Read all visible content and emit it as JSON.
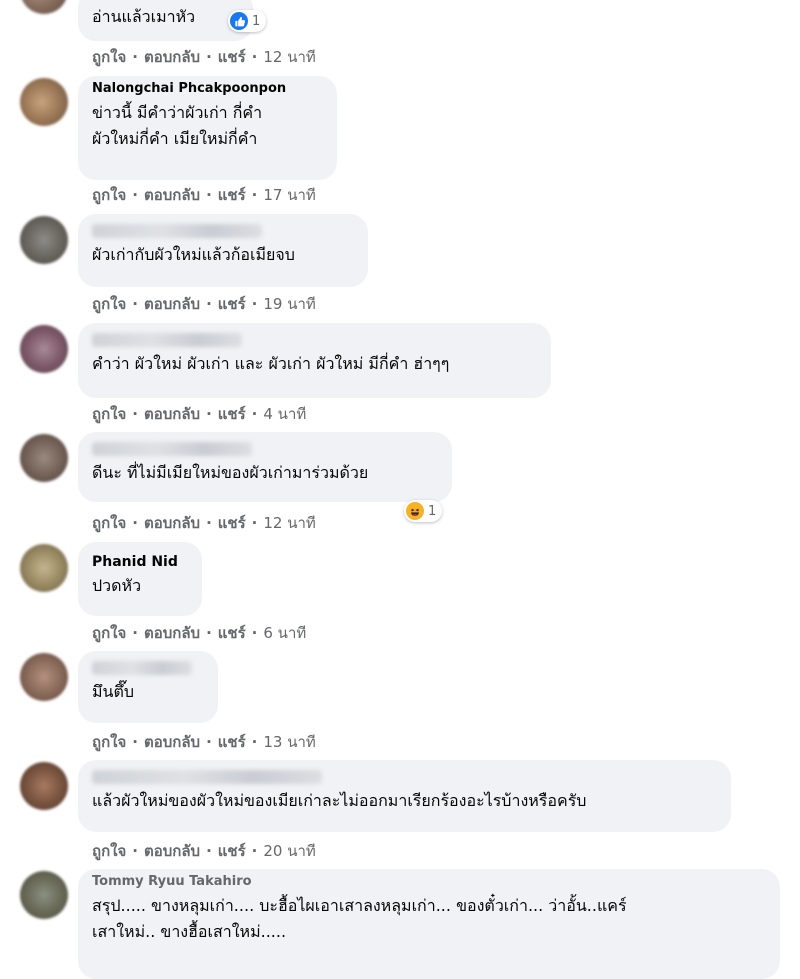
{
  "comments": [
    {
      "author": "",
      "text": [
        "อ่านแล้วเมาหัว"
      ],
      "actions": {
        "like": "ถูกใจ",
        "reply": "ตอบกลับ",
        "share": "แชร์",
        "time": "12 นาที"
      },
      "reaction": {
        "type": "like-icon",
        "count": "1"
      }
    },
    {
      "author": "Nalongchai Phcakpoonpon",
      "text": [
        "ข่าวนี้ มีคำว่าผัวเก่า กี่คำ",
        "ผัวใหม่กี่คำ เมียใหม่กี่คำ"
      ],
      "actions": {
        "like": "ถูกใจ",
        "reply": "ตอบกลับ",
        "share": "แชร์",
        "time": "17 นาที"
      }
    },
    {
      "author": "",
      "text": [
        "ผัวเก่ากับผัวใหม่แล้วก้อเมียจบ"
      ],
      "actions": {
        "like": "ถูกใจ",
        "reply": "ตอบกลับ",
        "share": "แชร์",
        "time": "19 นาที"
      }
    },
    {
      "author": "",
      "text": [
        "คำว่า ผัวใหม่ ผัวเก่า และ ผัวเก่า ผัวใหม่ มีกี่คำ ฮ่าๆๆ"
      ],
      "actions": {
        "like": "ถูกใจ",
        "reply": "ตอบกลับ",
        "share": "แชร์",
        "time": "4 นาที"
      }
    },
    {
      "author": "",
      "text": [
        "ดีนะ ที่ไม่มีเมียใหม่ของผัวเก่ามาร่วมด้วย"
      ],
      "actions": {
        "like": "ถูกใจ",
        "reply": "ตอบกลับ",
        "share": "แชร์",
        "time": "12 นาที"
      },
      "reaction": {
        "type": "haha-icon",
        "count": "1"
      }
    },
    {
      "author": "Phanid Nid",
      "text": [
        "ปวดหัว"
      ],
      "actions": {
        "like": "ถูกใจ",
        "reply": "ตอบกลับ",
        "share": "แชร์",
        "time": "6 นาที"
      }
    },
    {
      "author": "",
      "text": [
        "มึนตึ๊บ"
      ],
      "actions": {
        "like": "ถูกใจ",
        "reply": "ตอบกลับ",
        "share": "แชร์",
        "time": "13 นาที"
      }
    },
    {
      "author": "",
      "text": [
        "แล้วผัวใหม่ของผัวใหม่ของเมียเก่าละไม่ออกมาเรียกร้องอะไรบ้างหรือครับ"
      ],
      "actions": {
        "like": "ถูกใจ",
        "reply": "ตอบกลับ",
        "share": "แชร์",
        "time": "20 นาที"
      }
    },
    {
      "author": "Tommy Ryuu Takahiro",
      "text": [
        "สรุป..... ขางหลุมเก่า.... บะฮื้อไผเอาเสาลงหลุมเก่า... ของตั๋วเก่า... ว่าอั้น..แคร์",
        "เสาใหม่.. ขางฮื้อเสาใหม่....."
      ]
    }
  ]
}
